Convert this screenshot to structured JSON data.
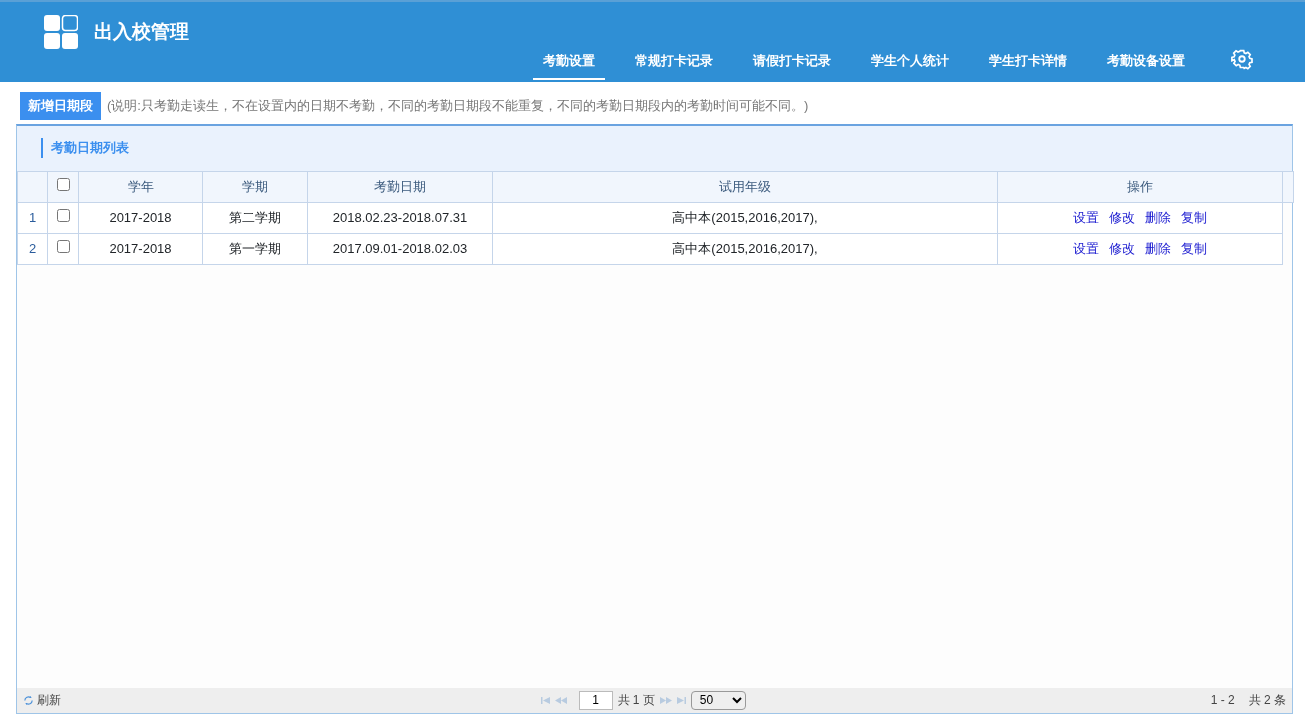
{
  "app": {
    "title": "出入校管理"
  },
  "nav_tabs": [
    {
      "label": "考勤设置",
      "selected": true
    },
    {
      "label": "常规打卡记录",
      "selected": false
    },
    {
      "label": "请假打卡记录",
      "selected": false
    },
    {
      "label": "学生个人统计",
      "selected": false
    },
    {
      "label": "学生打卡详情",
      "selected": false
    },
    {
      "label": "考勤设备设置",
      "selected": false
    }
  ],
  "toolbar": {
    "add_button": "新增日期段",
    "note": "(说明:只考勤走读生，不在设置内的日期不考勤，不同的考勤日期段不能重复，不同的考勤日期段内的考勤时间可能不同。)"
  },
  "panel": {
    "title": "考勤日期列表"
  },
  "table": {
    "select_all_checked": false,
    "columns": [
      "学年",
      "学期",
      "考勤日期",
      "试用年级",
      "操作"
    ],
    "rows": [
      {
        "index": "1",
        "checked": false,
        "cells": [
          "2017-2018",
          "第二学期",
          "2018.02.23-2018.07.31",
          "高中本(2015,2016,2017),"
        ],
        "actions": [
          "设置",
          "修改",
          "删除",
          "复制"
        ]
      },
      {
        "index": "2",
        "checked": false,
        "cells": [
          "2017-2018",
          "第一学期",
          "2017.09.01-2018.02.03",
          "高中本(2015,2016,2017),"
        ],
        "actions": [
          "设置",
          "修改",
          "删除",
          "复制"
        ]
      }
    ]
  },
  "footer": {
    "refresh": "刷新",
    "page": "1",
    "page_total": "共 1 页",
    "page_size": "50",
    "range": "1 - 2",
    "total": "共 2 条"
  }
}
